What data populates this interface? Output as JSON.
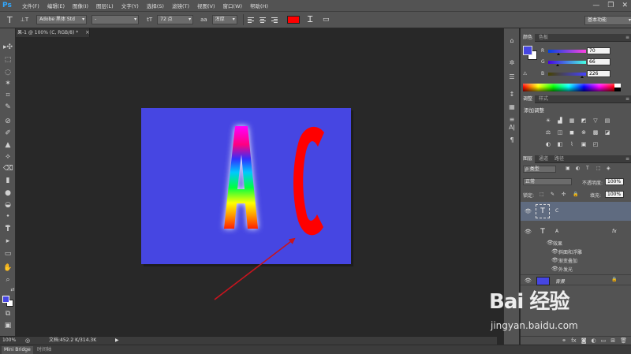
{
  "app": {
    "logo": "Ps"
  },
  "menu": [
    "文件(F)",
    "编辑(E)",
    "图像(I)",
    "图层(L)",
    "文字(Y)",
    "选择(S)",
    "滤镜(T)",
    "视图(V)",
    "窗口(W)",
    "帮助(H)"
  ],
  "window_controls": {
    "minimize": "—",
    "restore": "❐",
    "close": "✕"
  },
  "options": {
    "tool_icon": "T",
    "orient_icon": "⊥T",
    "font_family": "Adobe 黑体 Std",
    "font_style": "-",
    "size_icon": "tT",
    "font_size": "72 点",
    "aa_icon": "aa",
    "antialias": "浑厚",
    "text_color": "#ff0000",
    "warp_icon": "Ꮖ",
    "panel_icon": "▭",
    "workspace": "基本功能"
  },
  "tools": [
    "▸✣",
    "⬚",
    "◌",
    "✶",
    "⌗",
    "✎",
    "⊘",
    "✐",
    "▲",
    "⟡",
    "⌫",
    "▮",
    "●",
    "◒",
    "⬩",
    "✒",
    "T",
    "▸",
    "▭",
    "✋",
    "⌕",
    "⇄",
    "⧉",
    "▣"
  ],
  "colors": {
    "foreground": "#4646e2",
    "background": "#ffffff"
  },
  "document": {
    "tab_title": "果-1 @ 100% (C, RGB/8) *",
    "tab_close": "×",
    "canvas_bg": "#4646e2",
    "letter_a": "A",
    "letter_c": "C",
    "letter_c_color": "#ff0000",
    "arrow_color": "#c8141e"
  },
  "status": {
    "zoom": "100%",
    "status_icon": "◎",
    "doc_size": "文档:452.2 K/314.3K",
    "arrow": "▶"
  },
  "bottom_tabs": {
    "mini_bridge": "Mini Bridge",
    "timeline": "时间轴"
  },
  "icon_strip": [
    "⌂",
    "✲",
    "☰",
    "↕",
    "▦",
    "≡",
    "Aǀ",
    "¶"
  ],
  "color_panel": {
    "tabs": [
      "颜色",
      "色板"
    ],
    "channels": [
      {
        "label": "R",
        "value": "70",
        "thumb": 0.27
      },
      {
        "label": "G",
        "value": "66",
        "thumb": 0.26
      },
      {
        "label": "B",
        "value": "226",
        "thumb": 0.89
      }
    ],
    "warning_icon": "⚠"
  },
  "adjust_panel": {
    "tabs": [
      "调整",
      "样式"
    ],
    "title": "添加调整",
    "icons": [
      "☀",
      "▟",
      "▦",
      "◩",
      "▽",
      "▤",
      "⚖",
      "◫",
      "◼",
      "⊗",
      "▩",
      "◪",
      "◐",
      "◧",
      "⌇",
      "▣",
      "◰"
    ]
  },
  "layers_panel": {
    "tabs": [
      "图层",
      "通道",
      "路径"
    ],
    "filter": "ρ 类型",
    "filter_icons": [
      "▣",
      "◐",
      "T",
      "⬚",
      "◈"
    ],
    "blend_mode": "正常",
    "opacity_label": "不透明度:",
    "opacity": "100%",
    "lock_label": "锁定:",
    "lock_icons": [
      "⬚",
      "✎",
      "✣",
      "🔒"
    ],
    "fill_label": "填充:",
    "fill": "100%",
    "layers": [
      {
        "name": "C",
        "thumb": "T"
      },
      {
        "name": "A",
        "thumb": "T",
        "fx": "fx",
        "effects_label": "效果",
        "effects": [
          "斜面和浮雕",
          "渐变叠加",
          "外发光"
        ]
      },
      {
        "name": "背景",
        "lock": "🔒"
      }
    ],
    "footer_icons": [
      "⚭",
      "fx",
      "◙",
      "◐",
      "▭",
      "⊞",
      "🗑"
    ]
  },
  "watermark": {
    "brand": "Bai 经验",
    "url": "jingyan.baidu.com"
  }
}
